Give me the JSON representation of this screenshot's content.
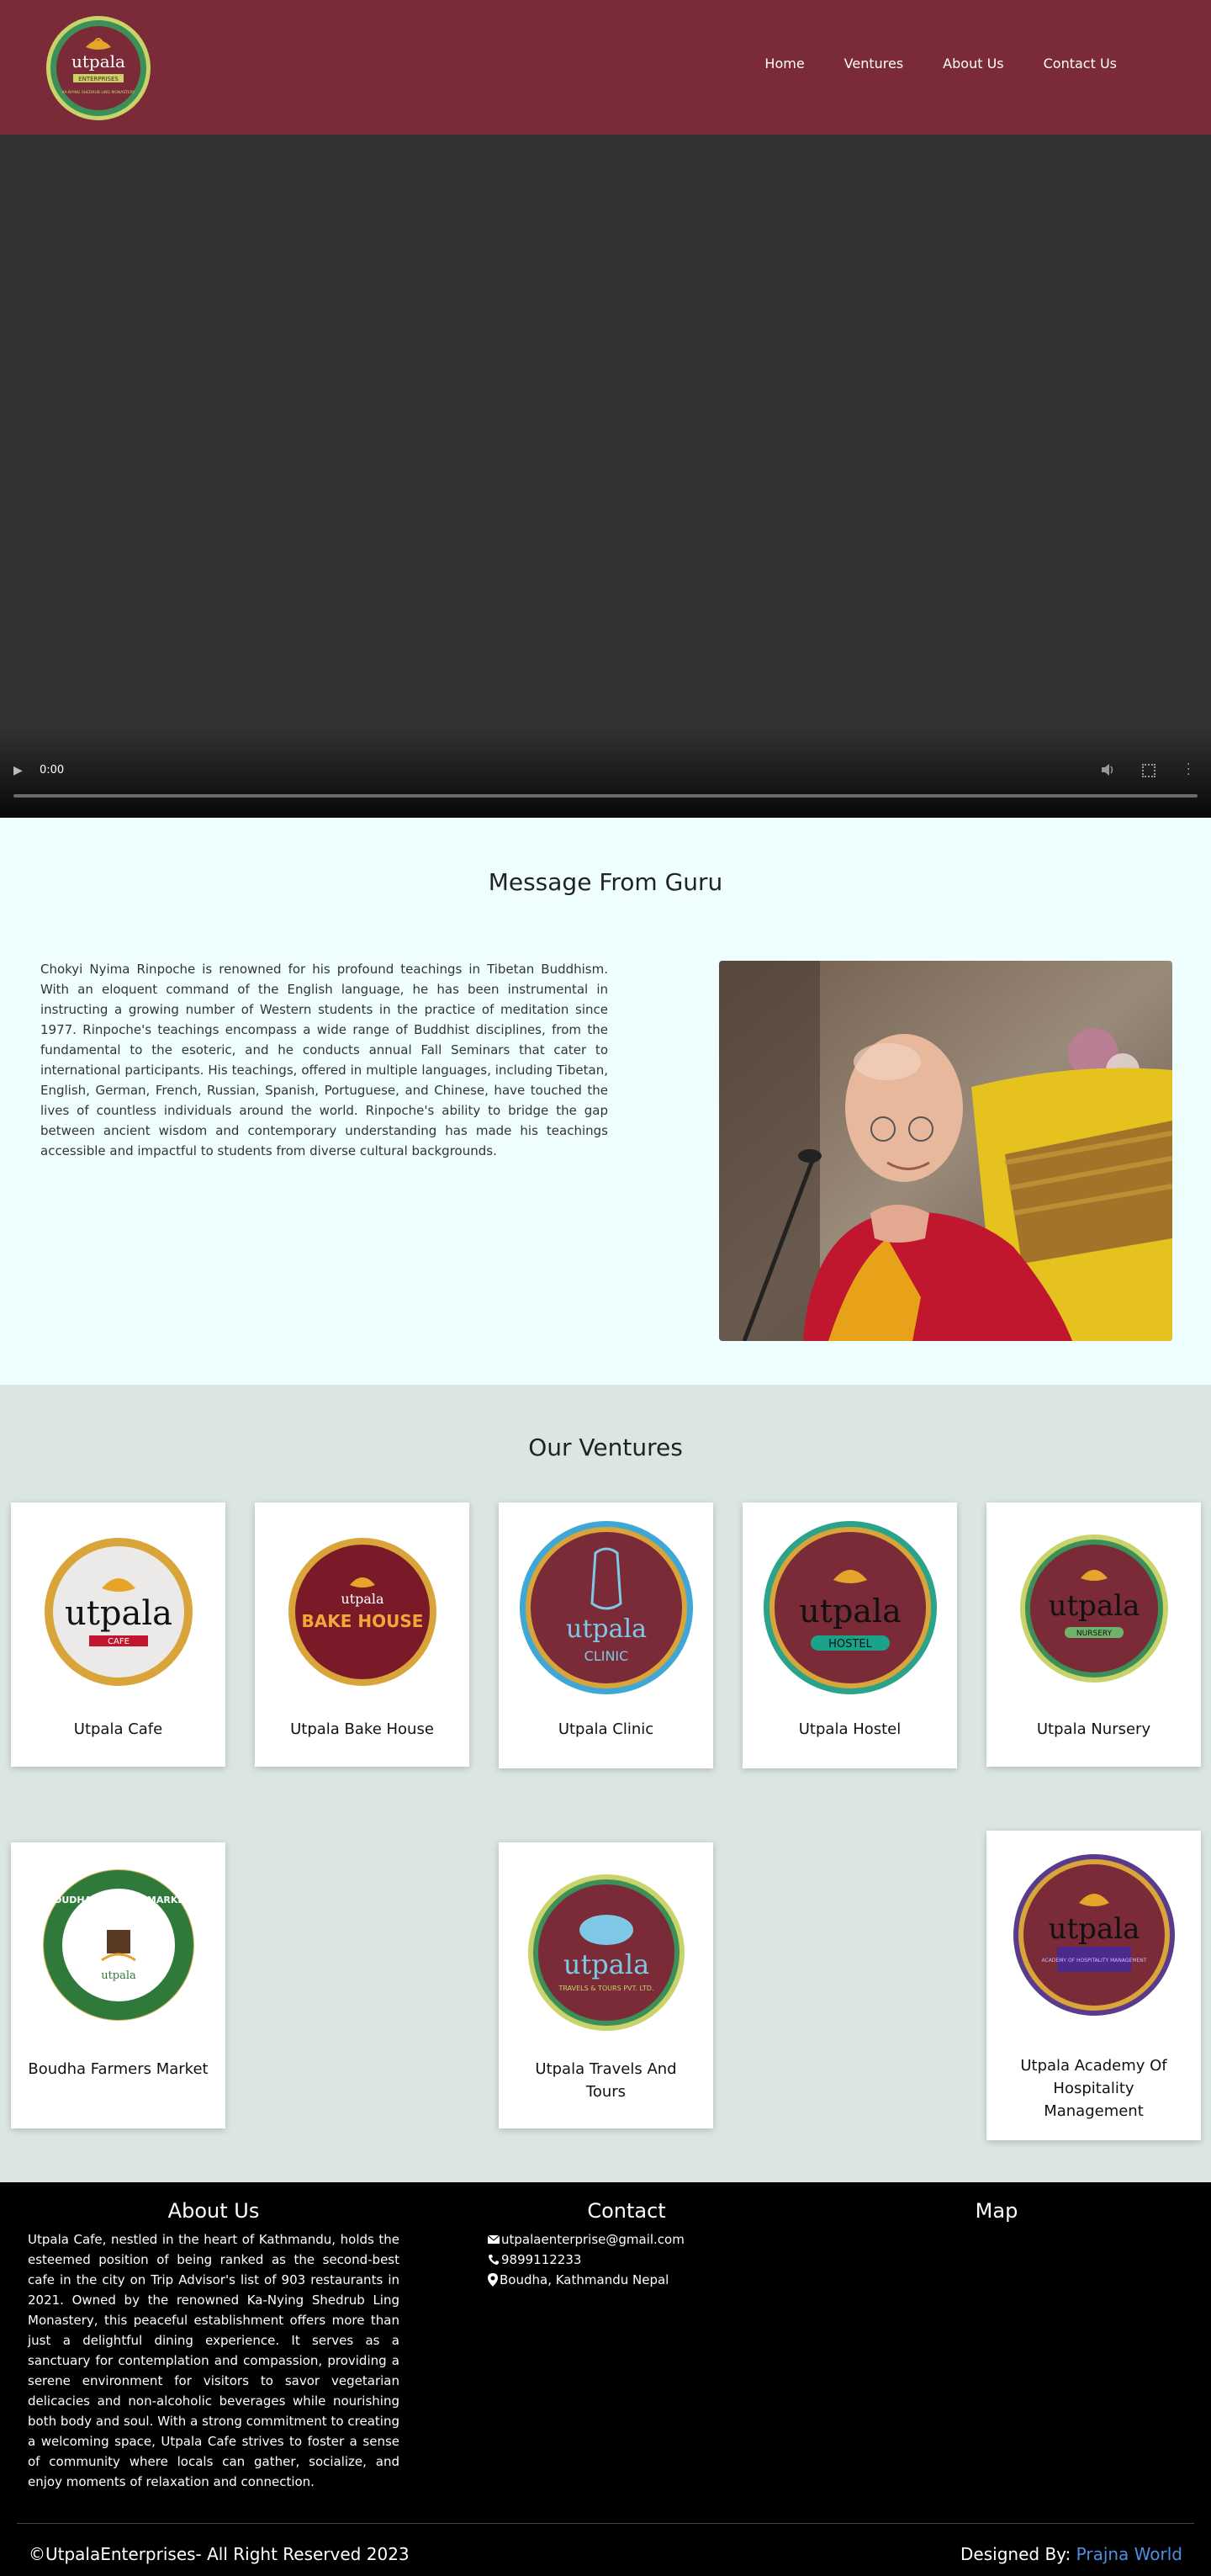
{
  "header": {
    "logo_text": "utpala",
    "logo_sub": "ENTERPRISES",
    "logo_ring": "KA-NYING SHEDRUB LING MONASTERY",
    "nav": [
      {
        "label": "Home"
      },
      {
        "label": "Ventures"
      },
      {
        "label": "About Us"
      },
      {
        "label": "Contact Us"
      }
    ]
  },
  "video": {
    "time": "0:00",
    "progress": 0
  },
  "guru": {
    "title": "Message From Guru",
    "text": "Chokyi Nyima Rinpoche is renowned for his profound teachings in Tibetan Buddhism. With an eloquent command of the English language, he has been instrumental in instructing a growing number of Western students in the practice of meditation since 1977. Rinpoche's teachings encompass a wide range of Buddhist disciplines, from the fundamental to the esoteric, and he conducts annual Fall Seminars that cater to international participants. His teachings, offered in multiple languages, including Tibetan, English, German, French, Russian, Spanish, Portuguese, and Chinese, have touched the lives of countless individuals around the world. Rinpoche's ability to bridge the gap between ancient wisdom and contemporary understanding has made his teachings accessible and impactful to students from diverse cultural backgrounds."
  },
  "ventures": {
    "title": "Our Ventures",
    "items": [
      {
        "name": "Utpala Cafe",
        "logo_text": "utpala",
        "logo_tag": "CAFE"
      },
      {
        "name": "Utpala Bake House",
        "logo_text": "utpala",
        "logo_tag": "BAKE HOUSE"
      },
      {
        "name": "Utpala Clinic",
        "logo_text": "utpala",
        "logo_tag": "CLINIC"
      },
      {
        "name": "Utpala Hostel",
        "logo_text": "utpala",
        "logo_tag": "HOSTEL"
      },
      {
        "name": "Utpala Nursery",
        "logo_text": "utpala",
        "logo_tag": "NURSERY"
      },
      {
        "name": "Boudha Farmers Market",
        "logo_text": "BOUDHA FARMERS MARKET",
        "logo_tag": "utpala"
      },
      {
        "name": "Utpala Travels And Tours",
        "logo_text": "utpala",
        "logo_tag": "TRAVELS & TOURS PVT. LTD."
      },
      {
        "name": "Utpala Academy Of Hospitality Management",
        "logo_text": "utpala",
        "logo_tag": "ACADEMY OF HOSPITALITY MANAGEMENT"
      }
    ]
  },
  "footer": {
    "about_title": "About Us",
    "about_text": "Utpala Cafe, nestled in the heart of Kathmandu, holds the esteemed position of being ranked as the second-best cafe in the city on Trip Advisor's list of 903 restaurants in 2021. Owned by the renowned Ka-Nying Shedrub Ling Monastery, this peaceful establishment offers more than just a delightful dining experience. It serves as a sanctuary for contemplation and compassion, providing a serene environment for visitors to savor vegetarian delicacies and non-alcoholic beverages while nourishing both body and soul. With a strong commitment to creating a welcoming space, Utpala Cafe strives to foster a sense of community where locals can gather, socialize, and enjoy moments of relaxation and connection.",
    "contact_title": "Contact",
    "email": "utpalaenterprise@gmail.com",
    "phone": "9899112233",
    "address": "Boudha, Kathmandu Nepal",
    "map_title": "Map",
    "copyright": "©UtpalaEnterprises- All Right Reserved 2023",
    "designed_by": "Designed By:",
    "designer": "Prajna World"
  },
  "colors": {
    "brand": "#7a2b37",
    "link": "#4d8fe0"
  }
}
